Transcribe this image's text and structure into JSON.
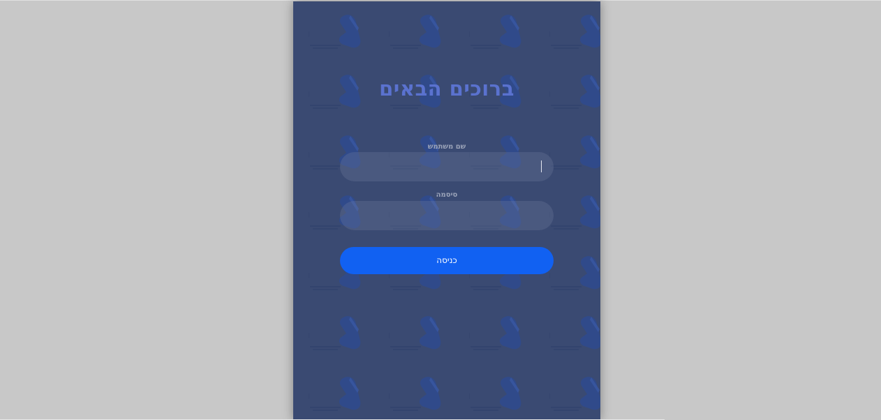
{
  "login": {
    "title": "ברוכים הבאים",
    "username_label": "שם משתמש",
    "username_value": "",
    "password_label": "סיסמה",
    "password_value": "",
    "submit_label": "כניסה"
  },
  "watermark": {
    "logo_text": "ידיד"
  },
  "colors": {
    "page_bg": "#c8c8c8",
    "panel_bg": "#3a4a72",
    "title": "#5a72cf",
    "button": "#1161f2"
  }
}
